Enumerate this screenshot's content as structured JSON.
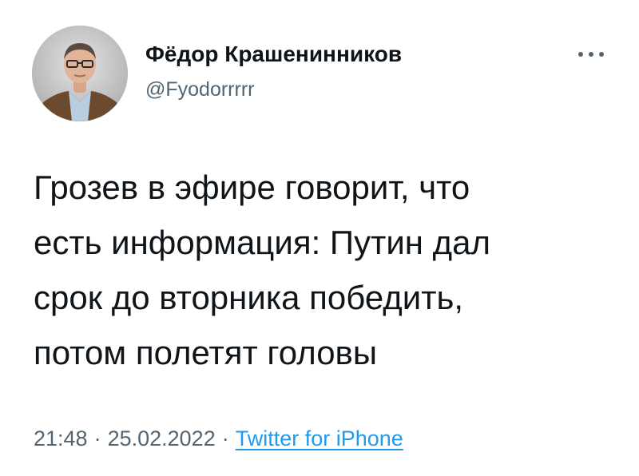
{
  "author": {
    "display_name": "Фёдор Крашенинников",
    "handle": "@Fyodorrrrr"
  },
  "tweet": {
    "text": "Грозев в эфире говорит, что\nесть информация: Путин дал\nсрок до вторника победить,\nпотом полетят головы"
  },
  "meta": {
    "time": "21:48",
    "separator": "·",
    "date": "25.02.2022",
    "source": "Twitter for iPhone"
  },
  "icons": {
    "more": "more-horizontal-icon",
    "avatar": "profile-photo"
  },
  "colors": {
    "text": "#0f1419",
    "secondary": "#536471",
    "link": "#1d9bf0"
  }
}
